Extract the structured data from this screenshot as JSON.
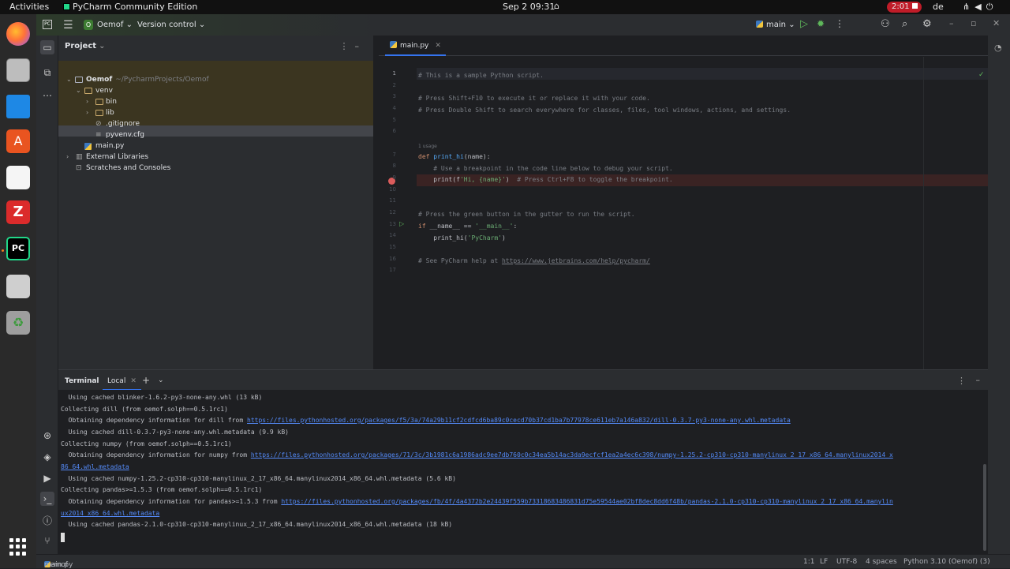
{
  "topbar": {
    "activities": "Activities",
    "app_name": "PyCharm Community Edition",
    "clock": "Sep 2  09:31",
    "recording": "2:01",
    "lang": "de"
  },
  "mainbar": {
    "logo": "PC",
    "project_badge": "O",
    "project_name": "Oemof",
    "vcs": "Version control",
    "run_config": "main"
  },
  "project": {
    "title": "Project",
    "root_name": "Oemof",
    "root_path": "~/PycharmProjects/Oemof",
    "items": {
      "venv": "venv",
      "bin": "bin",
      "lib": "lib",
      "gitignore": ".gitignore",
      "pyvenv": "pyvenv.cfg",
      "main": "main.py",
      "external": "External Libraries",
      "scratches": "Scratches and Consoles"
    }
  },
  "editor": {
    "tab_label": "main.py",
    "usage_hint": "1 usage",
    "line_numbers": [
      "1",
      "2",
      "3",
      "4",
      "5",
      "6",
      "7",
      "8",
      "9",
      "10",
      "11",
      "12",
      "13",
      "14",
      "15",
      "16",
      "17"
    ],
    "lines": {
      "l1": "# This is a sample Python script.",
      "l3": "# Press Shift+F10 to execute it or replace it with your code.",
      "l4": "# Press Double Shift to search everywhere for classes, files, tool windows, actions, and settings.",
      "l7_kw": "def",
      "l7_fn": "print_hi",
      "l7_rest": "(name):",
      "l8": "    # Use a breakpoint in the code line below to debug your script.",
      "l9_a": "    print(f",
      "l9_str": "'Hi, {name}'",
      "l9_b": ")  ",
      "l9_cmt": "# Press Ctrl+F8 to toggle the breakpoint.",
      "l12": "# Press the green button in the gutter to run the script.",
      "l13_kw": "if",
      "l13_a": " __name__ == ",
      "l13_str": "'__main__'",
      "l13_b": ":",
      "l14_a": "    print_hi(",
      "l14_str": "'PyCharm'",
      "l14_b": ")",
      "l16_cmt": "# See PyCharm help at ",
      "l16_link": "https://www.jetbrains.com/help/pycharm/"
    }
  },
  "terminal": {
    "title": "Terminal",
    "tab_label": "Local",
    "lines": {
      "t1": "  Using cached blinker-1.6.2-py3-none-any.whl (13 kB)",
      "t2": "Collecting dill (from oemof.solph==0.5.1rc1)",
      "t3_a": "  Obtaining dependency information for dill from ",
      "t3_link": "https://files.pythonhosted.org/packages/f5/3a/74a29b11cf2cdfcd6ba89c0cecd70b37cd1ba7b77978ce611eb7a146a832/dill-0.3.7-py3-none-any.whl.metadata",
      "t4": "  Using cached dill-0.3.7-py3-none-any.whl.metadata (9.9 kB)",
      "t5": "Collecting numpy (from oemof.solph==0.5.1rc1)",
      "t6_a": "  Obtaining dependency information for numpy from ",
      "t6_link": "https://files.pythonhosted.org/packages/71/3c/3b1981c6a1986adc9ee7db760c0c34ea5b14ac3da9ecfcf1ea2a4ec6c398/numpy-1.25.2-cp310-cp310-manylinux_2_17_x86_64.manylinux2014_x",
      "t6_link2": "86_64.whl.metadata",
      "t7": "  Using cached numpy-1.25.2-cp310-cp310-manylinux_2_17_x86_64.manylinux2014_x86_64.whl.metadata (5.6 kB)",
      "t8": "Collecting pandas>=1.5.3 (from oemof.solph==0.5.1rc1)",
      "t9_a": "  Obtaining dependency information for pandas>=1.5.3 from ",
      "t9_link": "https://files.pythonhosted.org/packages/fb/4f/4a4372b2e24439f559b73318683486831d75e59544ae02bf8dec8dd6f48b/pandas-2.1.0-cp310-cp310-manylinux_2_17_x86_64.manylin",
      "t9_link2": "ux2014_x86_64.whl.metadata",
      "t10": "  Using cached pandas-2.1.0-cp310-cp310-manylinux_2_17_x86_64.manylinux2014_x86_64.whl.metadata (18 kB)"
    }
  },
  "status": {
    "breadcrumb_project": "Oemof",
    "breadcrumb_file": "main.py",
    "position": "1:1",
    "line_sep": "LF",
    "encoding": "UTF-8",
    "indent": "4 spaces",
    "interpreter": "Python 3.10 (Oemof) (3)"
  },
  "colors": {
    "accent": "#3574f0",
    "run_green": "#5fb85b",
    "breakpoint_red": "#db5c5c",
    "recording_red": "#c01c28"
  }
}
